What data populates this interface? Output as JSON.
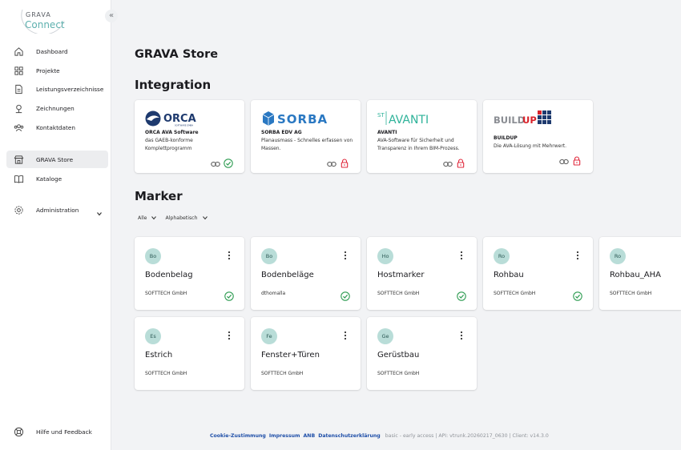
{
  "brand": {
    "logo_top": "GRAVA",
    "logo_bottom": "Connect"
  },
  "sidebar": {
    "collapse_icon": "chevron-double-left",
    "items": [
      {
        "label": "Dashboard",
        "icon": "home-icon"
      },
      {
        "label": "Projekte",
        "icon": "grid-icon"
      },
      {
        "label": "Leistungsverzeichnisse",
        "icon": "document-icon"
      },
      {
        "label": "Zeichnungen",
        "icon": "drawing-icon"
      },
      {
        "label": "Kontaktdaten",
        "icon": "contacts-icon"
      },
      {
        "label": "GRAVA Store",
        "icon": "store-icon",
        "active": true
      },
      {
        "label": "Kataloge",
        "icon": "book-icon"
      },
      {
        "label": "Administration",
        "icon": "gear-icon"
      }
    ],
    "help": {
      "label": "Hilfe und Feedback",
      "icon": "lifebuoy-icon"
    }
  },
  "main": {
    "title": "GRAVA Store",
    "integration": {
      "heading": "Integration",
      "cards": [
        {
          "logo": "ORCA",
          "logo_sub": "SOFTWARE GMBH",
          "name": "ORCA AVA Software",
          "desc": "das GAEB-konforme Komplettprogramm",
          "status": "active"
        },
        {
          "logo": "SORBA",
          "name": "SORBA EDV AG",
          "desc": "Planausmass - Schnelles erfassen von Massen.",
          "status": "locked"
        },
        {
          "logo": "AVANTI",
          "logo_prefix": "ST",
          "name": "AVANTI",
          "desc": "AVA-Software für Sicherheit und Transparenz in Ihrem BIM-Prozess.",
          "status": "locked"
        },
        {
          "logo": "BUILDUP",
          "logo_a": "BUILD",
          "logo_b": "UP",
          "name": "BUILDUP",
          "desc": "Die AVA-Lösung mit Mehrwert.",
          "status": "locked"
        }
      ]
    },
    "marker": {
      "heading": "Marker",
      "filters": [
        {
          "label": "Alle"
        },
        {
          "label": "Alphabetisch"
        }
      ],
      "cards": [
        {
          "initials": "Bo",
          "name": "Bodenbelag",
          "owner": "SOFTTECH GmbH",
          "checked": true
        },
        {
          "initials": "Bo",
          "name": "Bodenbeläge",
          "owner": "dthomalla",
          "checked": true
        },
        {
          "initials": "Ho",
          "name": "Hostmarker",
          "owner": "SOFTTECH GmbH",
          "checked": true
        },
        {
          "initials": "Ro",
          "name": "Rohbau",
          "owner": "SOFTTECH GmbH",
          "checked": true
        },
        {
          "initials": "Ro",
          "name": "Rohbau_AHA",
          "owner": "SOFTTECH GmbH",
          "checked": false
        },
        {
          "initials": "Es",
          "name": "Estrich",
          "owner": "SOFTTECH GmbH",
          "checked": false
        },
        {
          "initials": "Fe",
          "name": "Fenster+Türen",
          "owner": "SOFTTECH GmbH",
          "checked": false
        },
        {
          "initials": "Ge",
          "name": "Gerüstbau",
          "owner": "SOFTTECH GmbH",
          "checked": false
        }
      ]
    }
  },
  "footer": {
    "links": [
      "Cookie-Zustimmung",
      "Impressum",
      "ANB",
      "Datenschutzerklärung"
    ],
    "meta": "basic - early access | API: vtrunk.20260217_0630 | Client: v14.3.0"
  },
  "colors": {
    "check_green": "#2e9c52",
    "lock_red": "#e0283c",
    "link_blue": "#1f4fa8",
    "avatar_bg": "#b9ddd8"
  }
}
